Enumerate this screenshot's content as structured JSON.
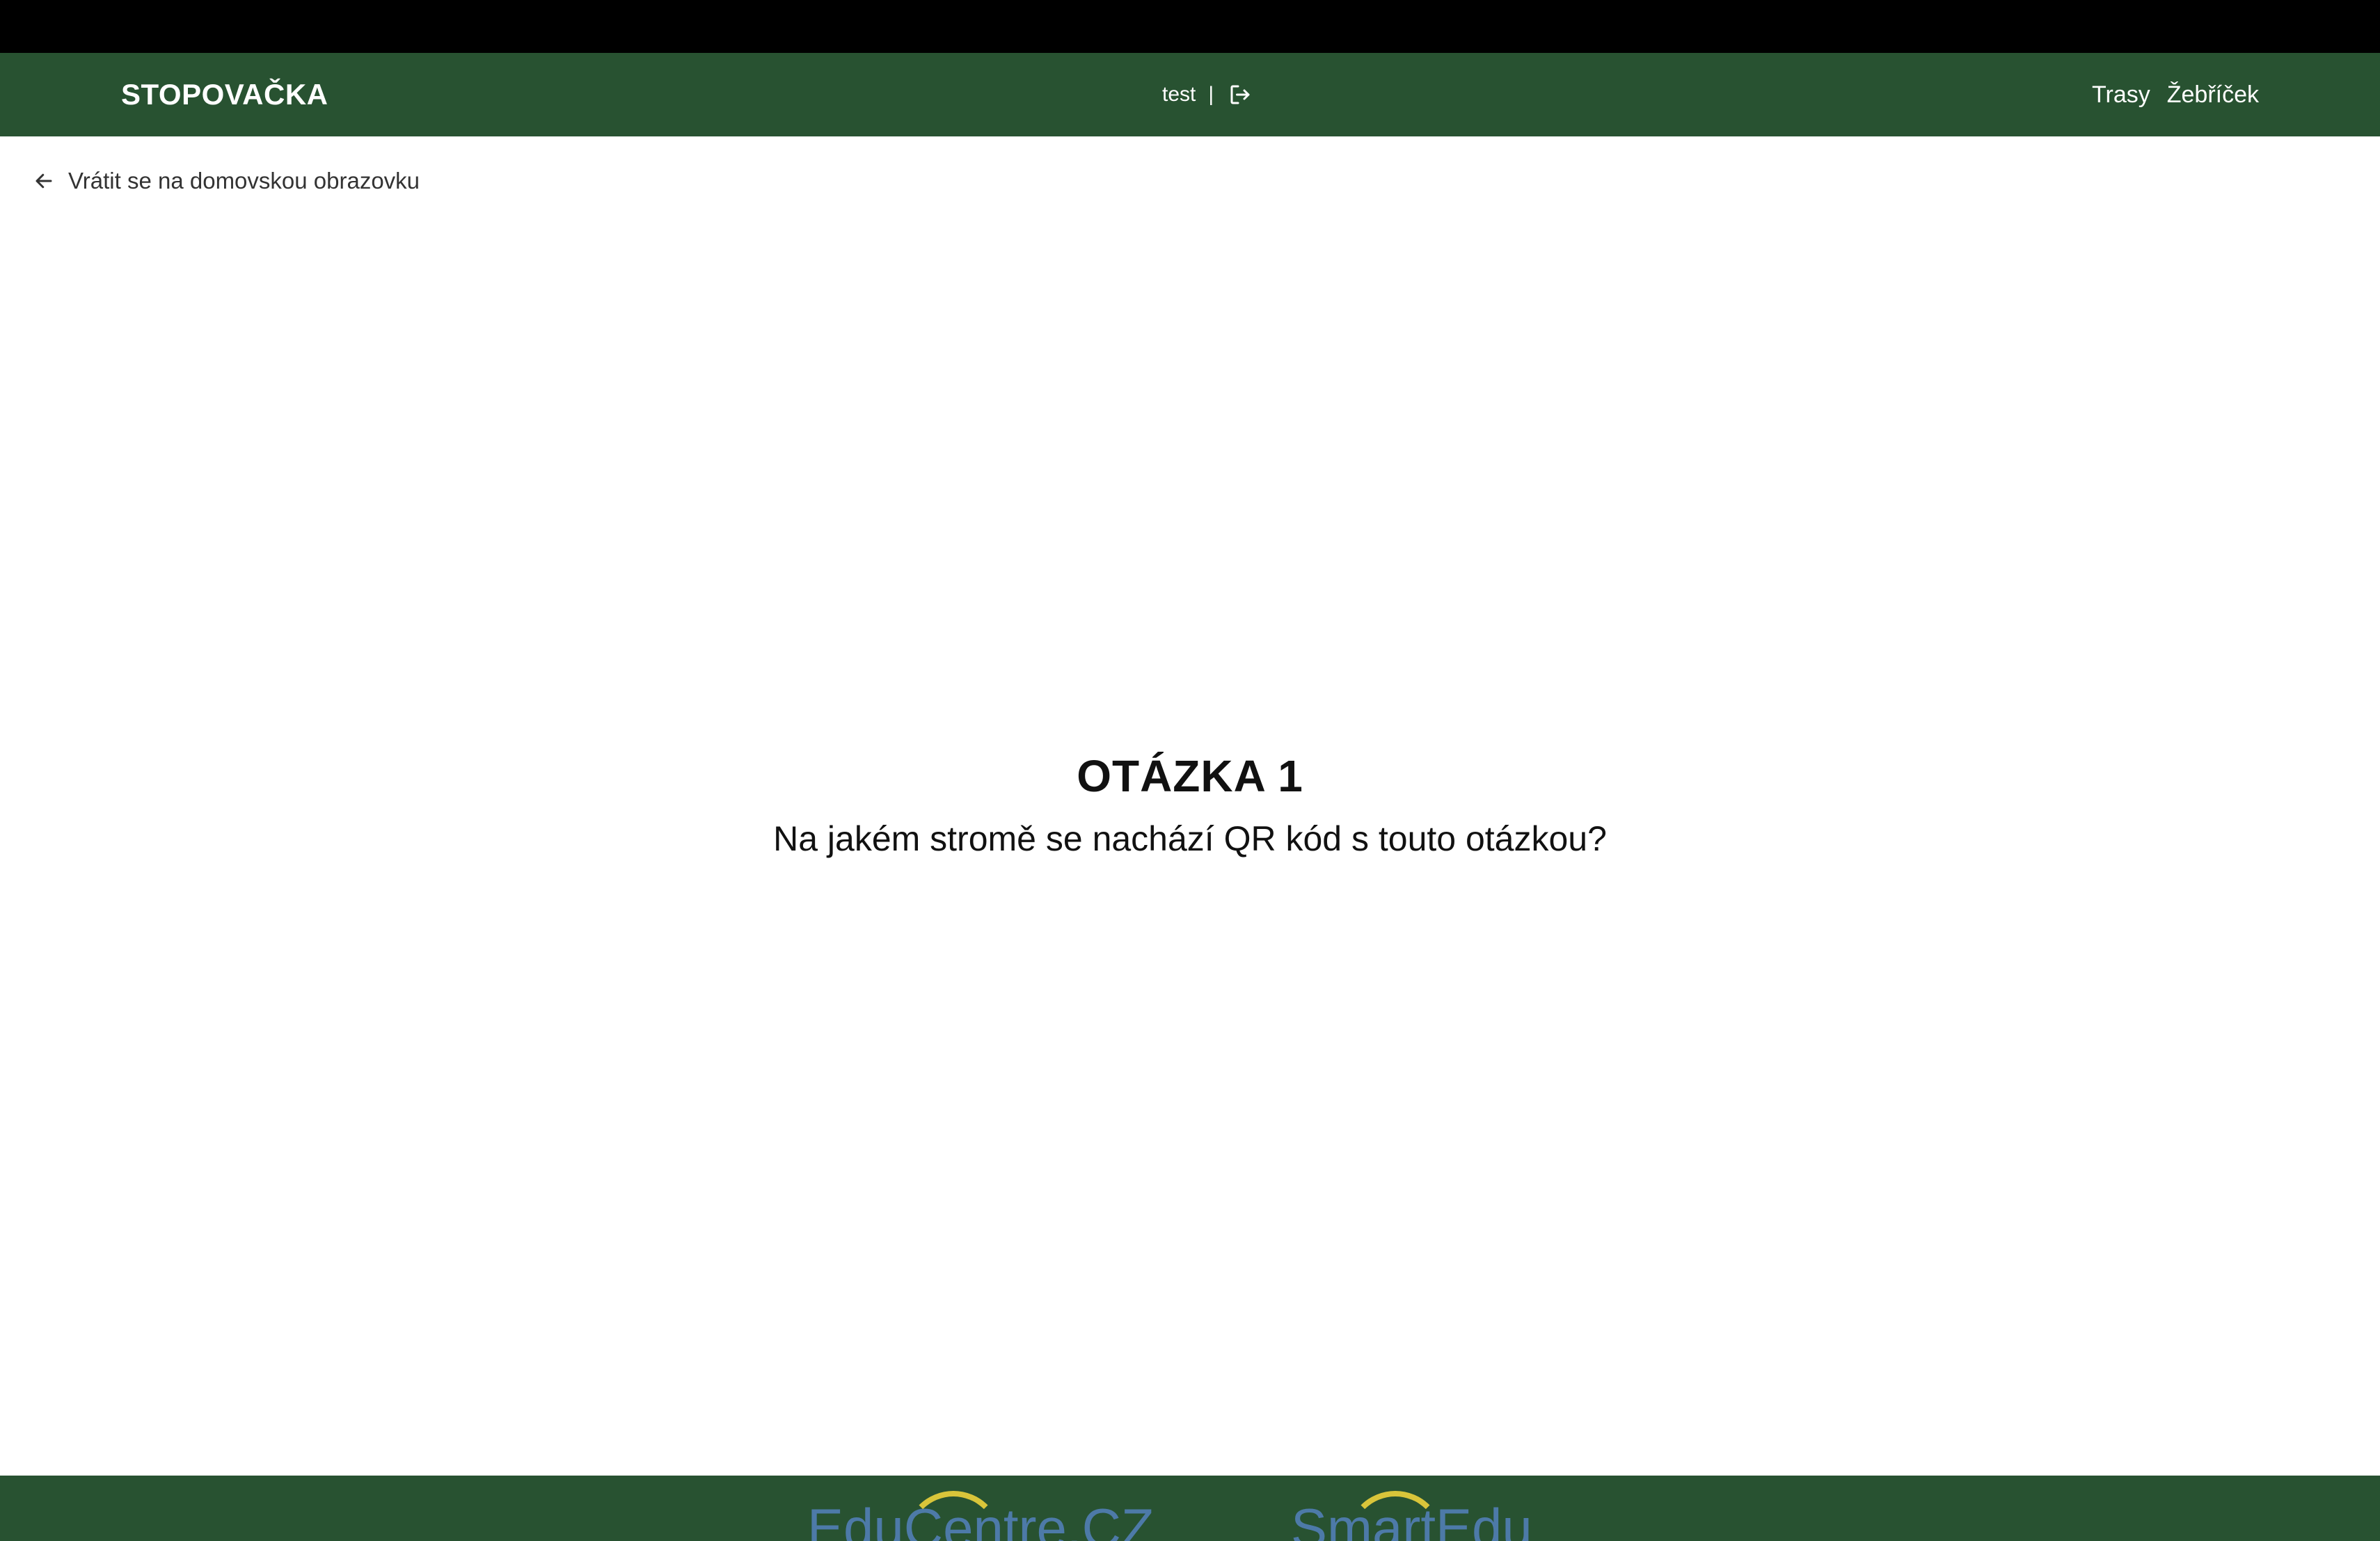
{
  "header": {
    "brand": "STOPOVAČKA",
    "user": "test",
    "separator": "|",
    "logout_icon": "logout-icon",
    "nav": [
      {
        "label": "Trasy"
      },
      {
        "label": "Žebříček"
      }
    ]
  },
  "back": {
    "label": "Vrátit se na domovskou obrazovku",
    "icon": "arrow-left-icon"
  },
  "question": {
    "title": "OTÁZKA 1",
    "text": "Na jakém stromě se nachází QR kód s touto otázkou?"
  },
  "footer": {
    "logos": [
      "EduCentre.CZ",
      "SmartEdu"
    ]
  },
  "colors": {
    "primary": "#285231",
    "text": "#111111",
    "logo_blue": "#4d7aa8",
    "logo_arc": "#d9c53a"
  }
}
